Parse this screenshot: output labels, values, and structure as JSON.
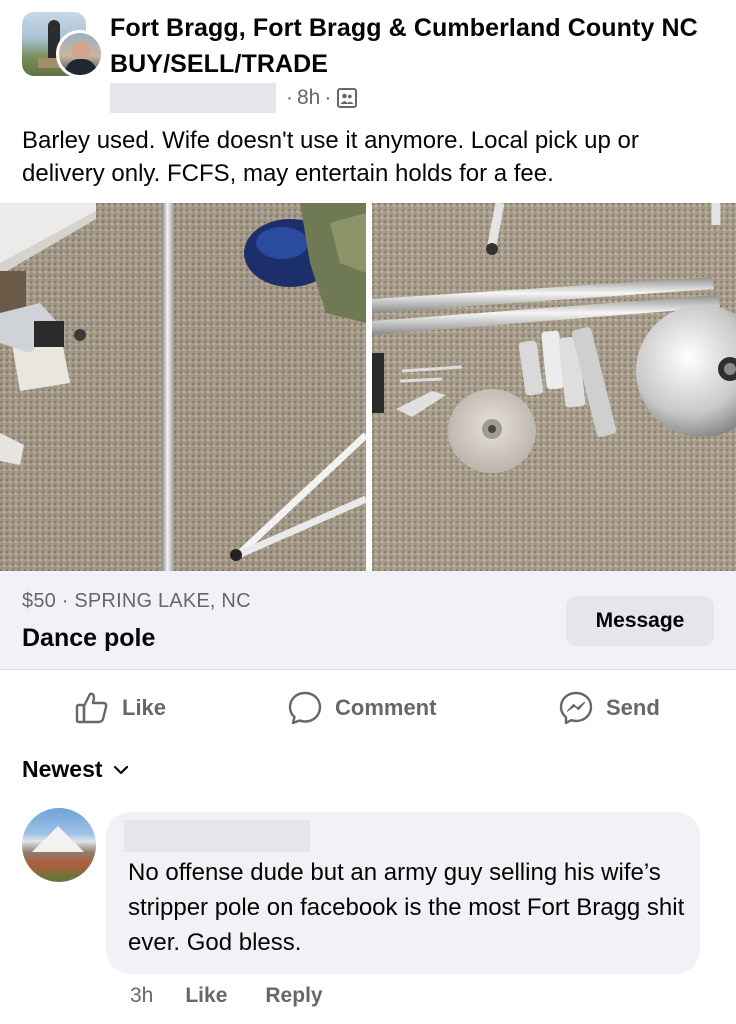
{
  "post": {
    "group_name": "Fort Bragg, Fort Bragg & Cumberland County NC BUY/SELL/TRADE",
    "time": "8h",
    "separator": "·",
    "text": "Barley used. Wife doesn't use it anymore. Local pick up or delivery only. FCFS, may entertain holds for a fee."
  },
  "listing": {
    "price_location": "$50 · SPRING LAKE, NC",
    "title": "Dance pole",
    "message_label": "Message"
  },
  "actions": {
    "like": "Like",
    "comment": "Comment",
    "send": "Send"
  },
  "comments": {
    "sort_label": "Newest",
    "items": [
      {
        "text": "No offense dude but an army guy selling his wife’s stripper pole on facebook is the most Fort Bragg shit ever. God bless.",
        "time": "3h",
        "like_label": "Like",
        "reply_label": "Reply"
      }
    ]
  },
  "icons": {
    "privacy": "group-members-icon",
    "like": "thumbs-up-icon",
    "comment": "speech-bubble-icon",
    "send": "messenger-icon",
    "sort": "chevron-down-icon"
  },
  "colors": {
    "secondary_text": "#65676b",
    "surface": "#f0f2f5",
    "button": "#e4e6eb"
  }
}
